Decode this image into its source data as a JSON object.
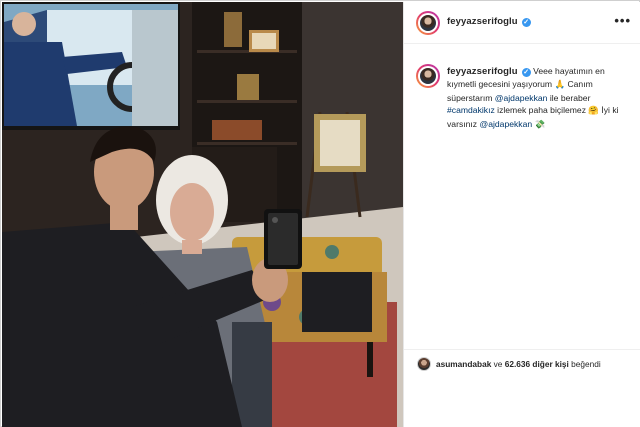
{
  "post": {
    "username": "feyyazserifoglu",
    "more_icon": "•••",
    "verified_icon": "✓"
  },
  "caption": {
    "username": "feyyazserifoglu",
    "part1": "Veee hayatımın en kıymetli gecesini yaşıyorum ",
    "emoji1": "🙏",
    "part2": " Canım süperstarım ",
    "mention1": "@ajdapekkan",
    "part3": " ile beraber ",
    "hashtag": "#camdakikız",
    "part4": " izlemek paha biçilemez ",
    "emoji2": "🤗",
    "part5": " İyi ki varsınız ",
    "mention2": "@ajdapekkan",
    "emoji3": "💸"
  },
  "likes": {
    "user": "asumandabak",
    "connector": " ve ",
    "count": "62.636 diğer kişi",
    "suffix": " beğendi"
  }
}
